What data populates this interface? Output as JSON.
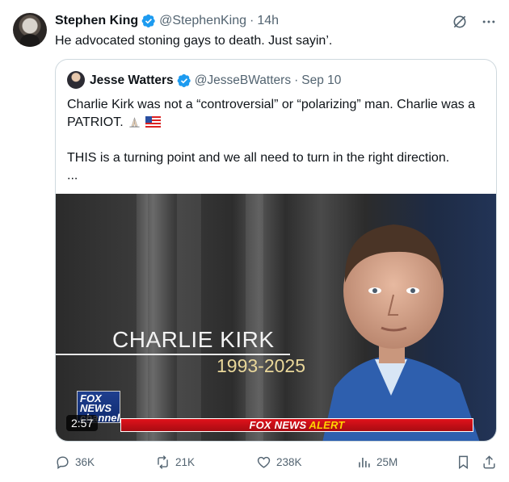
{
  "tweet": {
    "author_name": "Stephen King",
    "author_handle": "@StephenKing",
    "separator": "·",
    "time": "14h",
    "text": "He advocated stoning gays to death. Just sayin’."
  },
  "quote": {
    "author_name": "Jesse Watters",
    "author_handle": "@JesseBWatters",
    "separator": "·",
    "date": "Sep 10",
    "line1": "Charlie Kirk was not a “controversial” or “polarizing” man. Charlie was a PATRIOT.",
    "line2": "THIS is a turning point and we all need to turn in the right direction.",
    "more": "...",
    "video": {
      "name_overlay": "CHARLIE KIRK",
      "years_overlay": "1993-2025",
      "logo_text": "FOX NEWS channel",
      "alert_prefix": "FOX NEWS",
      "alert_word": "ALERT",
      "duration": "2:57"
    }
  },
  "actions": {
    "replies": "36K",
    "reposts": "21K",
    "likes": "238K",
    "views": "25M"
  },
  "colors": {
    "verified": "#1d9bf0",
    "muted": "#536471",
    "text": "#0f1419",
    "alert_red": "#e0121b",
    "alert_yellow": "#ffd400"
  }
}
